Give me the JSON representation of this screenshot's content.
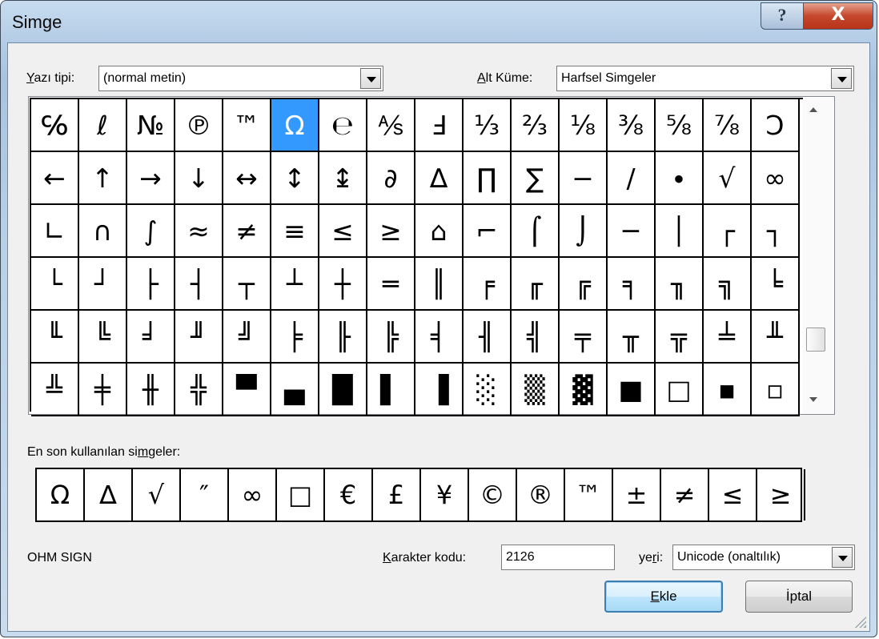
{
  "window": {
    "title": "Simge",
    "help_label": "?",
    "close_label": "X"
  },
  "font": {
    "label": "Yazı tipi:",
    "value": "(normal metin)"
  },
  "subset": {
    "label": "Alt Küme:",
    "value": "Harfsel Simgeler"
  },
  "symbol_rows": [
    [
      "℅",
      "ℓ",
      "№",
      "℗",
      "™",
      "Ω",
      "℮",
      "⅍",
      "Ⅎ",
      "⅓",
      "⅔",
      "⅛",
      "⅜",
      "⅝",
      "⅞",
      "Ↄ"
    ],
    [
      "←",
      "↑",
      "→",
      "↓",
      "↔",
      "↕",
      "↨",
      "∂",
      "∆",
      "∏",
      "∑",
      "−",
      "∕",
      "∙",
      "√",
      "∞"
    ],
    [
      "∟",
      "∩",
      "∫",
      "≈",
      "≠",
      "≡",
      "≤",
      "≥",
      "⌂",
      "⌐",
      "⌠",
      "⌡",
      "─",
      "│",
      "┌",
      "┐"
    ],
    [
      "└",
      "┘",
      "├",
      "┤",
      "┬",
      "┴",
      "┼",
      "═",
      "║",
      "╒",
      "╓",
      "╔",
      "╕",
      "╖",
      "╗",
      "╘"
    ],
    [
      "╙",
      "╚",
      "╛",
      "╜",
      "╝",
      "╞",
      "╟",
      "╠",
      "╡",
      "╢",
      "╣",
      "╤",
      "╥",
      "╦",
      "╧",
      "╨"
    ],
    [
      "╩",
      "╪",
      "╫",
      "╬",
      "▀",
      "▄",
      "█",
      "▌",
      "▐",
      "░",
      "▒",
      "▓",
      "■",
      "□",
      "▪",
      "▫"
    ]
  ],
  "selected_symbol": "Ω",
  "recent": {
    "label": "En son kullanılan simgeler:",
    "symbols": [
      "Ω",
      "∆",
      "√",
      "″",
      "∞",
      "□",
      "€",
      "£",
      "¥",
      "©",
      "®",
      "™",
      "±",
      "≠",
      "≤",
      "≥"
    ]
  },
  "char_name": "OHM SIGN",
  "char_code": {
    "label": "Karakter kodu:",
    "value": "2126"
  },
  "from": {
    "label": "yeri:",
    "value": "Unicode (onaltılık)"
  },
  "buttons": {
    "insert": "Ekle",
    "cancel": "İptal"
  }
}
